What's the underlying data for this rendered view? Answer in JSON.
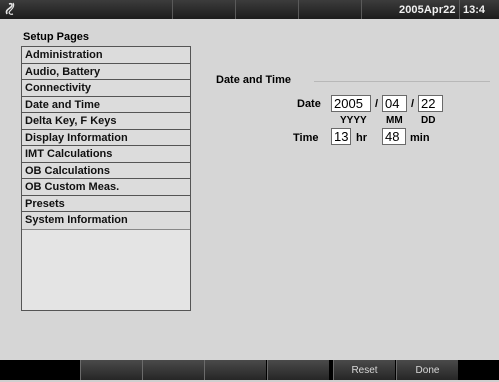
{
  "topbar": {
    "datetime": "2005Apr22",
    "clock": "13:4"
  },
  "setup": {
    "title": "Setup Pages",
    "items": [
      {
        "label": "Administration"
      },
      {
        "label": "Audio, Battery"
      },
      {
        "label": "Connectivity"
      },
      {
        "label": "Date and Time"
      },
      {
        "label": "Delta Key, F Keys"
      },
      {
        "label": "Display Information"
      },
      {
        "label": "IMT Calculations"
      },
      {
        "label": "OB Calculations"
      },
      {
        "label": "OB Custom Meas."
      },
      {
        "label": "Presets"
      },
      {
        "label": "System Information"
      }
    ]
  },
  "date_time": {
    "section_title": "Date and Time",
    "date_label": "Date",
    "year": "2005",
    "month": "04",
    "day": "22",
    "date_sep": "/",
    "year_unit": "YYYY",
    "month_unit": "MM",
    "day_unit": "DD",
    "time_label": "Time",
    "hour": "13",
    "hour_unit": "hr",
    "minute": "48",
    "minute_unit": "min"
  },
  "softkeys": {
    "reset": "Reset",
    "done": "Done"
  }
}
